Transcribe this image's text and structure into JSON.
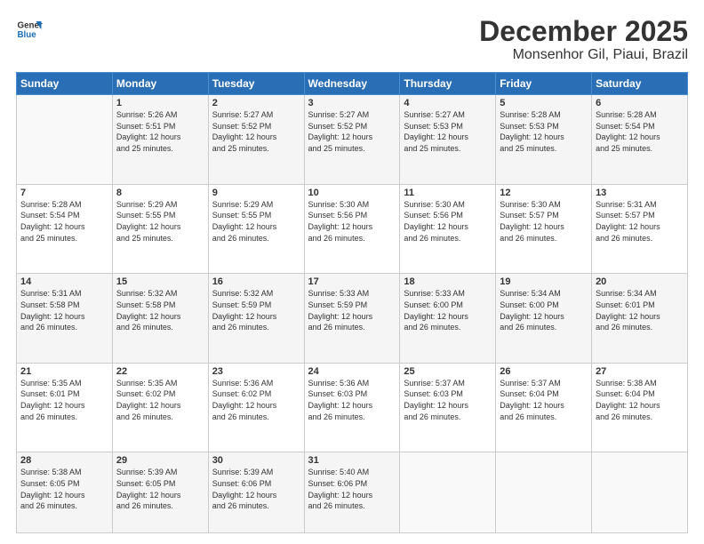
{
  "logo": {
    "line1": "General",
    "line2": "Blue"
  },
  "title": "December 2025",
  "subtitle": "Monsenhor Gil, Piaui, Brazil",
  "headers": [
    "Sunday",
    "Monday",
    "Tuesday",
    "Wednesday",
    "Thursday",
    "Friday",
    "Saturday"
  ],
  "weeks": [
    [
      {
        "day": "",
        "info": ""
      },
      {
        "day": "1",
        "info": "Sunrise: 5:26 AM\nSunset: 5:51 PM\nDaylight: 12 hours\nand 25 minutes."
      },
      {
        "day": "2",
        "info": "Sunrise: 5:27 AM\nSunset: 5:52 PM\nDaylight: 12 hours\nand 25 minutes."
      },
      {
        "day": "3",
        "info": "Sunrise: 5:27 AM\nSunset: 5:52 PM\nDaylight: 12 hours\nand 25 minutes."
      },
      {
        "day": "4",
        "info": "Sunrise: 5:27 AM\nSunset: 5:53 PM\nDaylight: 12 hours\nand 25 minutes."
      },
      {
        "day": "5",
        "info": "Sunrise: 5:28 AM\nSunset: 5:53 PM\nDaylight: 12 hours\nand 25 minutes."
      },
      {
        "day": "6",
        "info": "Sunrise: 5:28 AM\nSunset: 5:54 PM\nDaylight: 12 hours\nand 25 minutes."
      }
    ],
    [
      {
        "day": "7",
        "info": "Sunrise: 5:28 AM\nSunset: 5:54 PM\nDaylight: 12 hours\nand 25 minutes."
      },
      {
        "day": "8",
        "info": "Sunrise: 5:29 AM\nSunset: 5:55 PM\nDaylight: 12 hours\nand 25 minutes."
      },
      {
        "day": "9",
        "info": "Sunrise: 5:29 AM\nSunset: 5:55 PM\nDaylight: 12 hours\nand 26 minutes."
      },
      {
        "day": "10",
        "info": "Sunrise: 5:30 AM\nSunset: 5:56 PM\nDaylight: 12 hours\nand 26 minutes."
      },
      {
        "day": "11",
        "info": "Sunrise: 5:30 AM\nSunset: 5:56 PM\nDaylight: 12 hours\nand 26 minutes."
      },
      {
        "day": "12",
        "info": "Sunrise: 5:30 AM\nSunset: 5:57 PM\nDaylight: 12 hours\nand 26 minutes."
      },
      {
        "day": "13",
        "info": "Sunrise: 5:31 AM\nSunset: 5:57 PM\nDaylight: 12 hours\nand 26 minutes."
      }
    ],
    [
      {
        "day": "14",
        "info": "Sunrise: 5:31 AM\nSunset: 5:58 PM\nDaylight: 12 hours\nand 26 minutes."
      },
      {
        "day": "15",
        "info": "Sunrise: 5:32 AM\nSunset: 5:58 PM\nDaylight: 12 hours\nand 26 minutes."
      },
      {
        "day": "16",
        "info": "Sunrise: 5:32 AM\nSunset: 5:59 PM\nDaylight: 12 hours\nand 26 minutes."
      },
      {
        "day": "17",
        "info": "Sunrise: 5:33 AM\nSunset: 5:59 PM\nDaylight: 12 hours\nand 26 minutes."
      },
      {
        "day": "18",
        "info": "Sunrise: 5:33 AM\nSunset: 6:00 PM\nDaylight: 12 hours\nand 26 minutes."
      },
      {
        "day": "19",
        "info": "Sunrise: 5:34 AM\nSunset: 6:00 PM\nDaylight: 12 hours\nand 26 minutes."
      },
      {
        "day": "20",
        "info": "Sunrise: 5:34 AM\nSunset: 6:01 PM\nDaylight: 12 hours\nand 26 minutes."
      }
    ],
    [
      {
        "day": "21",
        "info": "Sunrise: 5:35 AM\nSunset: 6:01 PM\nDaylight: 12 hours\nand 26 minutes."
      },
      {
        "day": "22",
        "info": "Sunrise: 5:35 AM\nSunset: 6:02 PM\nDaylight: 12 hours\nand 26 minutes."
      },
      {
        "day": "23",
        "info": "Sunrise: 5:36 AM\nSunset: 6:02 PM\nDaylight: 12 hours\nand 26 minutes."
      },
      {
        "day": "24",
        "info": "Sunrise: 5:36 AM\nSunset: 6:03 PM\nDaylight: 12 hours\nand 26 minutes."
      },
      {
        "day": "25",
        "info": "Sunrise: 5:37 AM\nSunset: 6:03 PM\nDaylight: 12 hours\nand 26 minutes."
      },
      {
        "day": "26",
        "info": "Sunrise: 5:37 AM\nSunset: 6:04 PM\nDaylight: 12 hours\nand 26 minutes."
      },
      {
        "day": "27",
        "info": "Sunrise: 5:38 AM\nSunset: 6:04 PM\nDaylight: 12 hours\nand 26 minutes."
      }
    ],
    [
      {
        "day": "28",
        "info": "Sunrise: 5:38 AM\nSunset: 6:05 PM\nDaylight: 12 hours\nand 26 minutes."
      },
      {
        "day": "29",
        "info": "Sunrise: 5:39 AM\nSunset: 6:05 PM\nDaylight: 12 hours\nand 26 minutes."
      },
      {
        "day": "30",
        "info": "Sunrise: 5:39 AM\nSunset: 6:06 PM\nDaylight: 12 hours\nand 26 minutes."
      },
      {
        "day": "31",
        "info": "Sunrise: 5:40 AM\nSunset: 6:06 PM\nDaylight: 12 hours\nand 26 minutes."
      },
      {
        "day": "",
        "info": ""
      },
      {
        "day": "",
        "info": ""
      },
      {
        "day": "",
        "info": ""
      }
    ]
  ]
}
